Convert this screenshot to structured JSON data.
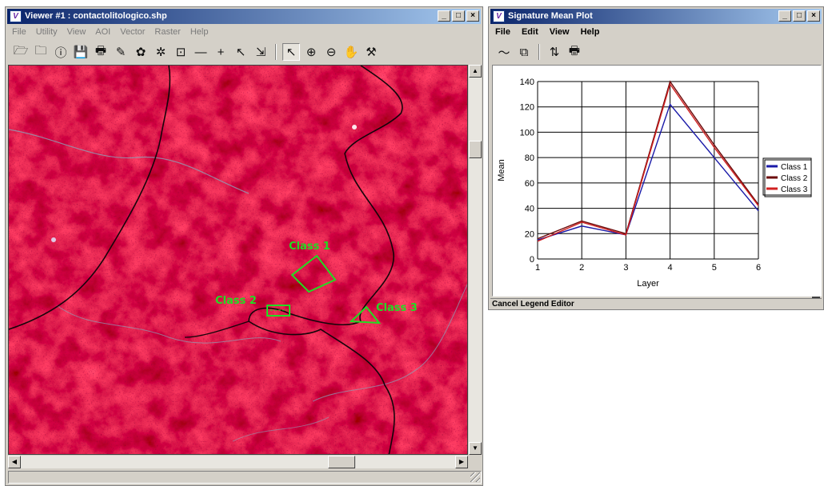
{
  "viewer": {
    "title": "Viewer #1 : contactolitologico.shp",
    "app_icon": "V",
    "window_controls": {
      "minimize": "_",
      "maximize": "□",
      "close": "×"
    },
    "menu": [
      "File",
      "Utility",
      "View",
      "AOI",
      "Vector",
      "Raster",
      "Help"
    ],
    "toolbar_icons": [
      "open-folder-icon",
      "open-layer-icon",
      "info-icon",
      "save-icon",
      "print-icon",
      "pencil-icon",
      "zoom-fit-icon",
      "snowflake-icon",
      "measure-icon",
      "line-icon",
      "crosshair-icon",
      "cursor-icon",
      "profile-icon",
      "select-arrow-icon",
      "zoom-in-icon",
      "zoom-out-icon",
      "pan-hand-icon",
      "inquire-icon"
    ],
    "toolbar_glyphs": [
      "🗁",
      "🗀",
      "ⓘ",
      "💾",
      "🖶",
      "✎",
      "✿",
      "✲",
      "⊡",
      "—",
      "+",
      "↖",
      "⇲",
      "↖",
      "⊕",
      "⊖",
      "✋",
      "⚒"
    ],
    "selected_tool": 13,
    "map": {
      "annotations": [
        {
          "label": "Class 1"
        },
        {
          "label": "Class 2"
        },
        {
          "label": "Class 3"
        }
      ],
      "annotation_color": "#22dd22",
      "image_color": "#8a0d1c"
    }
  },
  "signature": {
    "title": "Signature Mean Plot",
    "app_icon": "V",
    "window_controls": {
      "minimize": "_",
      "maximize": "□",
      "close": "×"
    },
    "menu": [
      "File",
      "Edit",
      "View",
      "Help"
    ],
    "toolbar_icons": [
      "line-style-icon",
      "multi-signature-icon",
      "switch-icon",
      "print-icon"
    ],
    "toolbar_glyphs": [
      "〜",
      "⧉",
      "⇅",
      "🖶"
    ],
    "status": "Cancel Legend Editor"
  },
  "chart_data": {
    "type": "line",
    "x": [
      1,
      2,
      3,
      4,
      5,
      6
    ],
    "xlabel": "Layer",
    "ylabel": "Mean",
    "xlim": [
      1,
      6
    ],
    "ylim": [
      0,
      140
    ],
    "yticks": [
      0,
      20,
      40,
      60,
      80,
      100,
      120,
      140
    ],
    "grid": true,
    "legend_position": "right",
    "series": [
      {
        "name": "Class 1",
        "color": "#1a1aa8",
        "values": [
          15,
          26,
          19,
          122,
          80,
          38
        ]
      },
      {
        "name": "Class 2",
        "color": "#6b0a0a",
        "values": [
          16,
          30,
          20,
          140,
          90,
          43
        ]
      },
      {
        "name": "Class 3",
        "color": "#d02020",
        "values": [
          14,
          29,
          19,
          138,
          88,
          42
        ]
      }
    ]
  }
}
